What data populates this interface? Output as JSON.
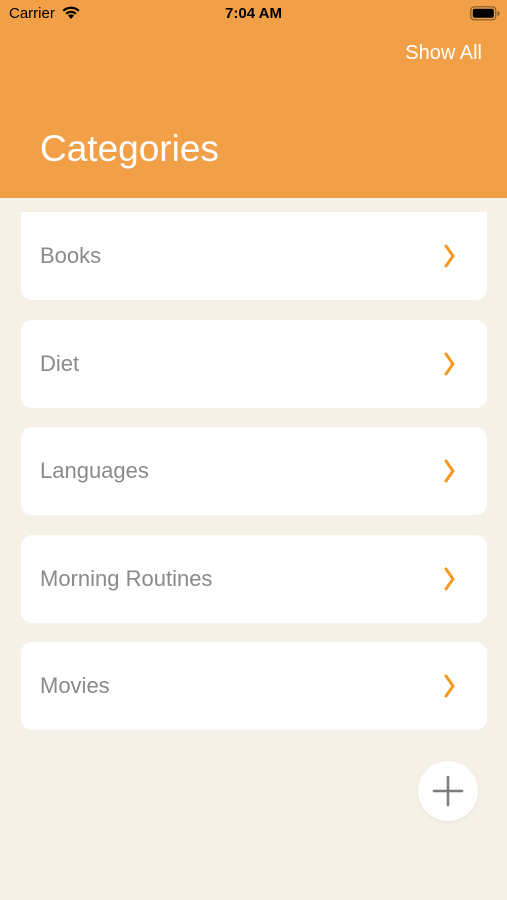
{
  "status_bar": {
    "carrier": "Carrier",
    "time": "7:04 AM",
    "wifi_icon": "wifi-icon",
    "battery_icon": "battery-icon"
  },
  "header": {
    "action_label": "Show All",
    "title": "Categories",
    "background_color": "#f2a048"
  },
  "categories": [
    {
      "label": "Books"
    },
    {
      "label": "Diet"
    },
    {
      "label": "Languages"
    },
    {
      "label": "Morning Routines"
    },
    {
      "label": "Movies"
    }
  ],
  "colors": {
    "accent": "#f39a1f",
    "background": "#f5f1e7",
    "item_text": "#8a8a8a"
  },
  "fab": {
    "icon": "plus-icon"
  }
}
